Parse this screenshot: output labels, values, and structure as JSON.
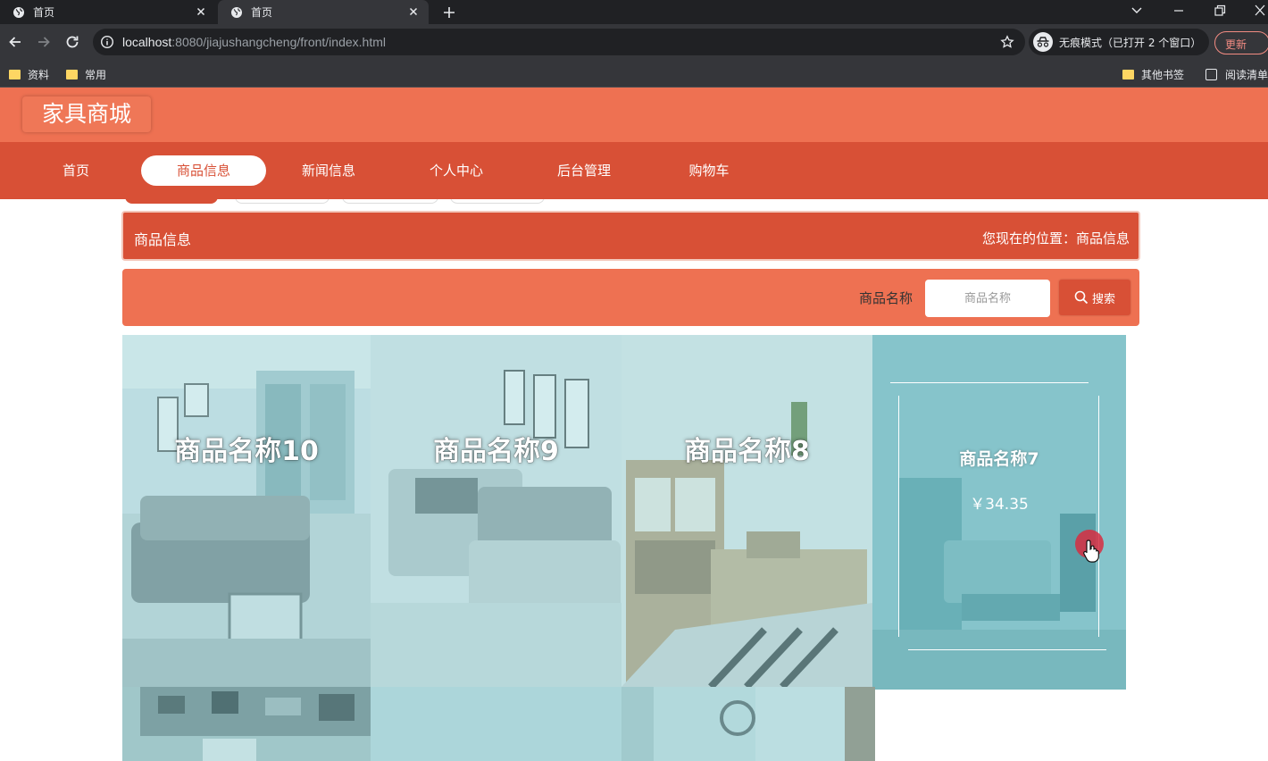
{
  "browser": {
    "tabs": [
      {
        "title": "首页"
      },
      {
        "title": "首页"
      }
    ],
    "url_host": "localhost",
    "url_rest": ":8080/jiajushangcheng/front/index.html",
    "profile_label": "无痕模式（已打开 2 个窗口）",
    "update_label": "更新",
    "bookmarks_left": [
      "资料",
      "常用"
    ],
    "bookmarks_other": "其他书签",
    "reading_list": "阅读清单"
  },
  "site": {
    "logo": "家具商城",
    "nav": [
      "首页",
      "商品信息",
      "新闻信息",
      "个人中心",
      "后台管理",
      "购物车"
    ],
    "active_nav": "商品信息"
  },
  "breadcrumb": {
    "title": "商品信息",
    "location_prefix": "您现在的位置：",
    "location_current": "商品信息"
  },
  "search": {
    "label": "商品名称",
    "placeholder": "商品名称",
    "button_label": "搜索"
  },
  "products": [
    {
      "name": "商品名称10"
    },
    {
      "name": "商品名称9"
    },
    {
      "name": "商品名称8"
    },
    {
      "name": "商品名称7",
      "price": "￥34.35"
    }
  ],
  "colors": {
    "header_top": "#ee7152",
    "nav_bar": "#d85036",
    "accent": "#d85036"
  }
}
